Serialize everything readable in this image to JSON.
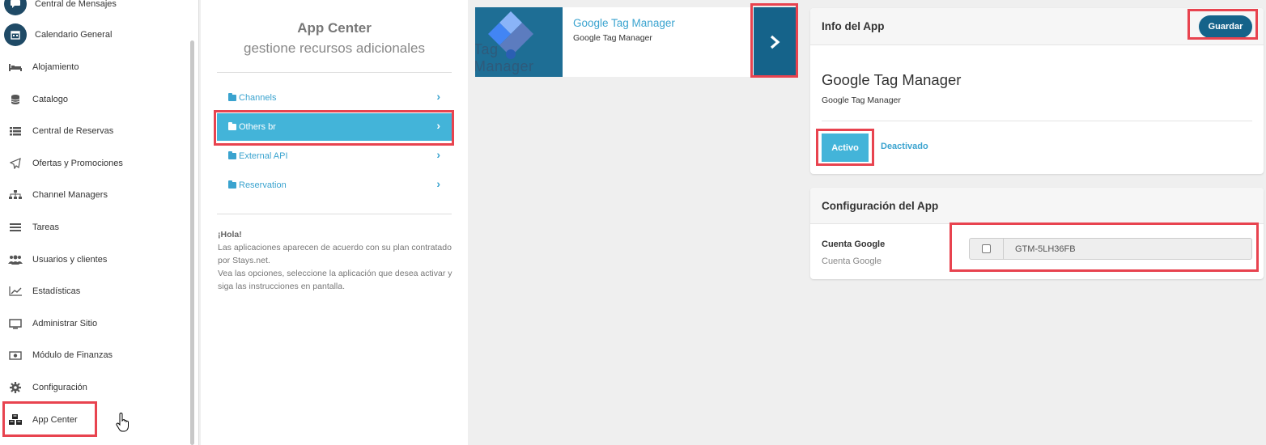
{
  "sidebar": {
    "items": [
      {
        "label": "Central de Mensajes",
        "icon": "chat-icon"
      },
      {
        "label": "Calendario General",
        "icon": "calendar-icon"
      },
      {
        "label": "Alojamiento",
        "icon": "bed-icon"
      },
      {
        "label": "Catalogo",
        "icon": "database-icon"
      },
      {
        "label": "Central de Reservas",
        "icon": "list-icon"
      },
      {
        "label": "Ofertas y Promociones",
        "icon": "paper-plane-icon"
      },
      {
        "label": "Channel Managers",
        "icon": "sitemap-icon"
      },
      {
        "label": "Tareas",
        "icon": "tasks-icon"
      },
      {
        "label": "Usuarios y clientes",
        "icon": "users-icon"
      },
      {
        "label": "Estadísticas",
        "icon": "line-chart-icon"
      },
      {
        "label": "Administrar Sitio",
        "icon": "monitor-icon"
      },
      {
        "label": "Módulo de Finanzas",
        "icon": "money-icon"
      },
      {
        "label": "Configuración",
        "icon": "gear-icon"
      },
      {
        "label": "App Center",
        "icon": "cubes-icon"
      }
    ]
  },
  "app_center": {
    "title": "App Center",
    "subtitle": "gestione recursos adicionales",
    "categories": [
      {
        "label": "Channels"
      },
      {
        "label": "Others br"
      },
      {
        "label": "External API"
      },
      {
        "label": "Reservation"
      }
    ],
    "help": {
      "title": "¡Hola!",
      "line1": "Las aplicaciones aparecen de acuerdo con su plan contratado por Stays.net.",
      "line2": "Vea las opciones, seleccione la aplicación que desea activar y siga las instrucciones en pantalla."
    }
  },
  "app_card": {
    "name": "Google Tag Manager",
    "subtitle": "Google Tag Manager",
    "thumb_text": "Tag Manager"
  },
  "info": {
    "header": "Info del App",
    "save_label": "Guardar",
    "app_name": "Google Tag Manager",
    "app_sub": "Google Tag Manager",
    "active_label": "Activo",
    "deactivate_label": "Deactivado"
  },
  "config": {
    "header": "Configuración del App",
    "field_label": "Cuenta Google",
    "field_help": "Cuenta Google",
    "field_value": "GTM-5LH36FB"
  },
  "colors": {
    "accent": "#43b4d9",
    "primary": "#15638a",
    "highlight": "#e8434f"
  }
}
